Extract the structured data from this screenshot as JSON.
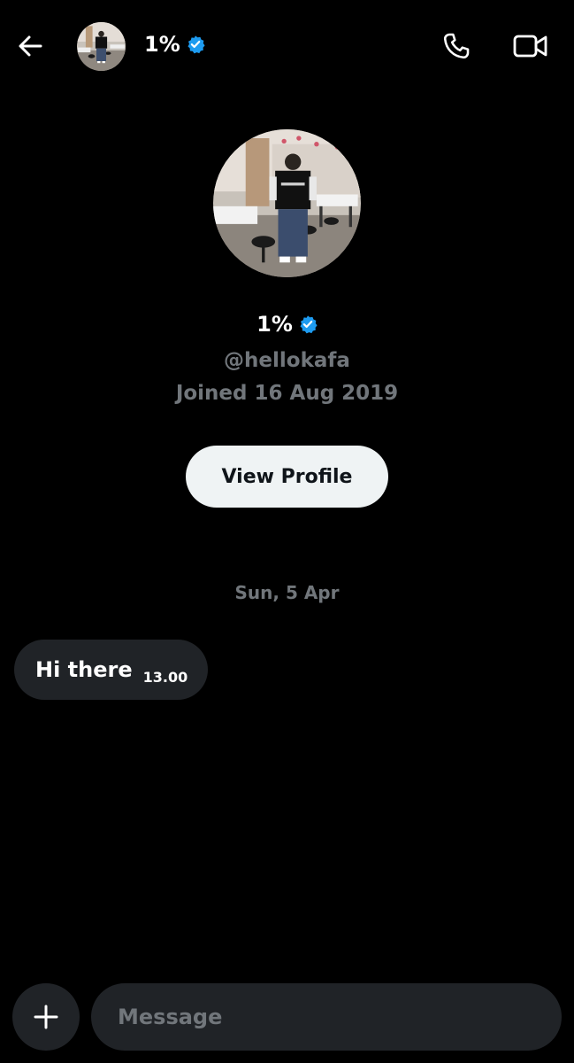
{
  "header": {
    "name": "1%",
    "verified_color": "#1d9bf0",
    "back_icon": "arrow-left-icon",
    "call_icon": "phone-icon",
    "video_icon": "video-camera-icon"
  },
  "profile": {
    "name": "1%",
    "handle": "@hellokafa",
    "joined": "Joined 16 Aug 2019",
    "view_profile_label": "View Profile"
  },
  "conversation": {
    "date_separator": "Sun, 5 Apr",
    "messages": [
      {
        "text": "Hi there",
        "time": "13.00"
      }
    ]
  },
  "composer": {
    "placeholder": "Message",
    "add_icon": "plus-icon"
  },
  "colors": {
    "background": "#000000",
    "bubble": "#202327",
    "muted_text": "#71767b",
    "button_bg": "#eff3f4"
  }
}
